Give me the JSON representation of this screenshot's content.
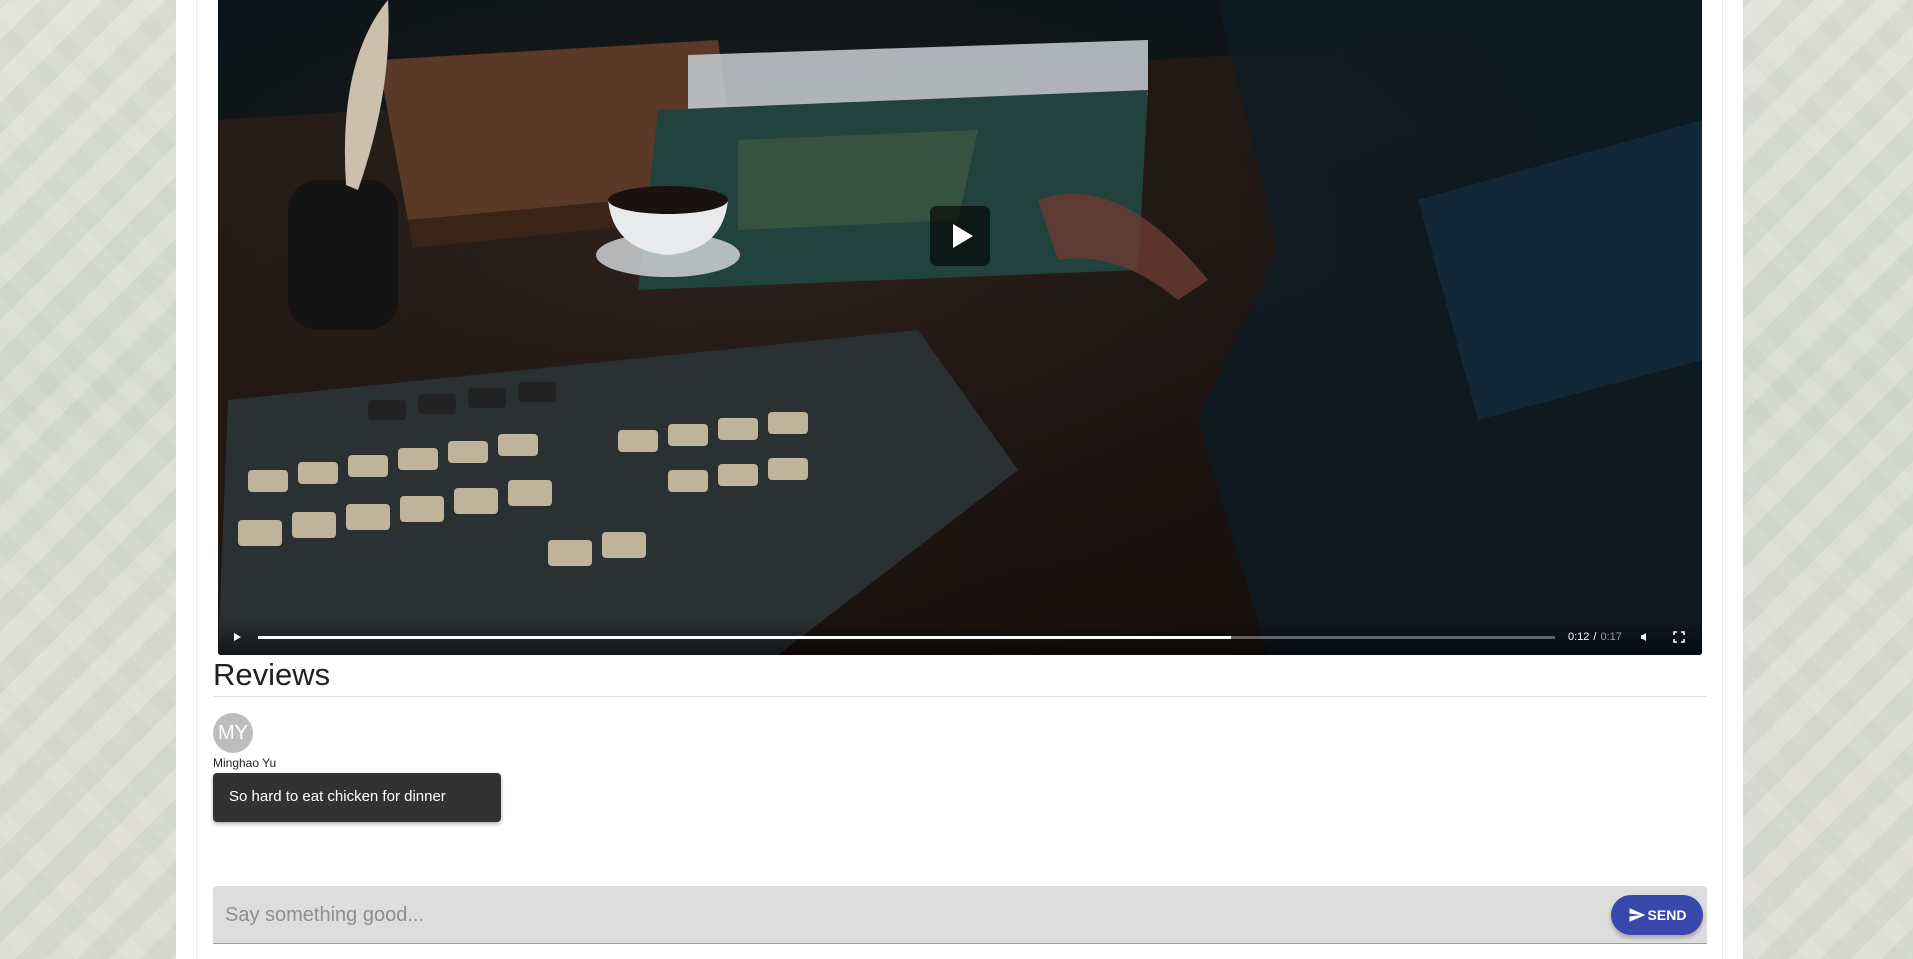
{
  "video": {
    "current_time": "0:12",
    "separator": "/",
    "duration": "0:17",
    "progress_fraction": 0.75
  },
  "reviews": {
    "title": "Reviews",
    "items": [
      {
        "avatar_initials": "MY",
        "author": "Minghao Yu",
        "comment": "So hard to eat chicken for dinner"
      }
    ]
  },
  "comment_form": {
    "placeholder": "Say something good...",
    "value": "",
    "send_label": "SEND",
    "send_color": "#3949ab"
  },
  "icons": {
    "play": "play-icon",
    "big_play": "big-play-icon",
    "mute": "volume-muted-icon",
    "fullscreen": "fullscreen-icon",
    "send": "send-icon"
  }
}
